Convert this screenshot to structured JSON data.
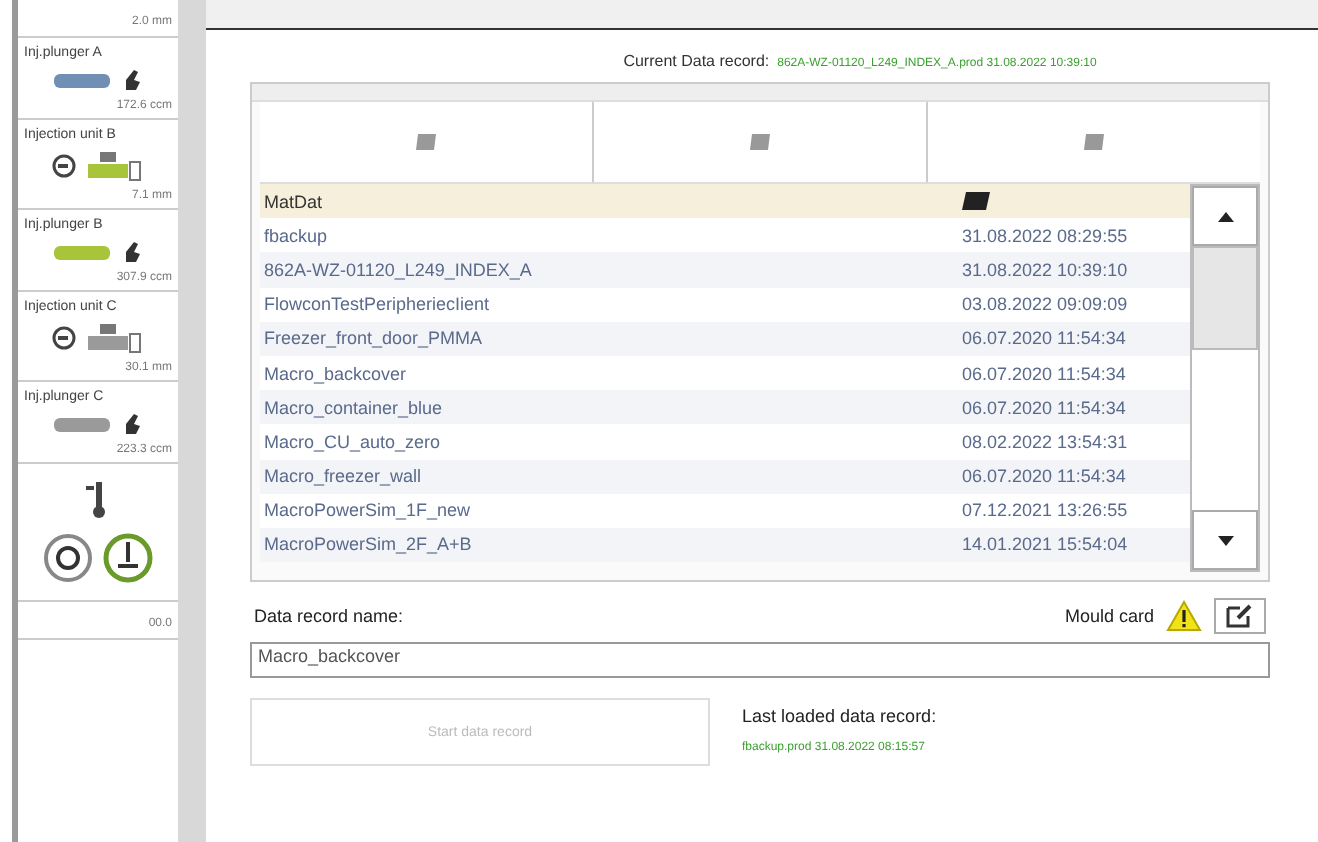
{
  "sidebar": {
    "items": [
      {
        "kind": "reading",
        "value": "2.0 mm"
      },
      {
        "kind": "plunger",
        "title": "Inj.plunger A",
        "color": "#6f8fb5",
        "value": "172.6 ccm"
      },
      {
        "kind": "unit",
        "title": "Injection unit B",
        "color": "#a8c43a",
        "value": "7.1 mm"
      },
      {
        "kind": "plunger",
        "title": "Inj.plunger B",
        "color": "#a8c43a",
        "value": "307.9 ccm"
      },
      {
        "kind": "unit",
        "title": "Injection unit C",
        "color": "#9a9a9a",
        "value": "30.1 mm"
      },
      {
        "kind": "plunger",
        "title": "Inj.plunger C",
        "color": "#9a9a9a",
        "value": "223.3 ccm"
      },
      {
        "kind": "controls"
      },
      {
        "kind": "reading",
        "value": "00.0"
      }
    ]
  },
  "current_record": {
    "label": "Current Data record:",
    "value": "862A-WZ-01120_L249_INDEX_A.prod 31.08.2022 10:39:10"
  },
  "table": {
    "rows": [
      {
        "name": "MatDat",
        "date": "",
        "selected": true
      },
      {
        "name": "fbackup",
        "date": "31.08.2022 08:29:55",
        "selected": false
      },
      {
        "name": "862A-WZ-01120_L249_INDEX_A",
        "date": "31.08.2022 10:39:10",
        "selected": false
      },
      {
        "name": "FlowconTestPeripheriecIient",
        "date": "03.08.2022 09:09:09",
        "selected": false
      },
      {
        "name": "Freezer_front_door_PMMA",
        "date": "06.07.2020 11:54:34",
        "selected": false
      },
      {
        "name": "Macro_backcover",
        "date": "06.07.2020 11:54:34",
        "selected": false
      },
      {
        "name": "Macro_container_blue",
        "date": "06.07.2020 11:54:34",
        "selected": false
      },
      {
        "name": "Macro_CU_auto_zero",
        "date": "08.02.2022 13:54:31",
        "selected": false
      },
      {
        "name": "Macro_freezer_wall",
        "date": "06.07.2020 11:54:34",
        "selected": false
      },
      {
        "name": "MacroPowerSim_1F_new",
        "date": "07.12.2021 13:26:55",
        "selected": false
      },
      {
        "name": "MacroPowerSim_2F_A+B",
        "date": "14.01.2021 15:54:04",
        "selected": false
      }
    ]
  },
  "record_name": {
    "label": "Data record name:",
    "value": "Macro_backcover"
  },
  "mould_card": {
    "label": "Mould card",
    "warning": true
  },
  "start_button": {
    "label": "Start data record",
    "disabled": true
  },
  "last_loaded": {
    "label": "Last loaded data record:",
    "value": "fbackup.prod 31.08.2022 08:15:57"
  }
}
